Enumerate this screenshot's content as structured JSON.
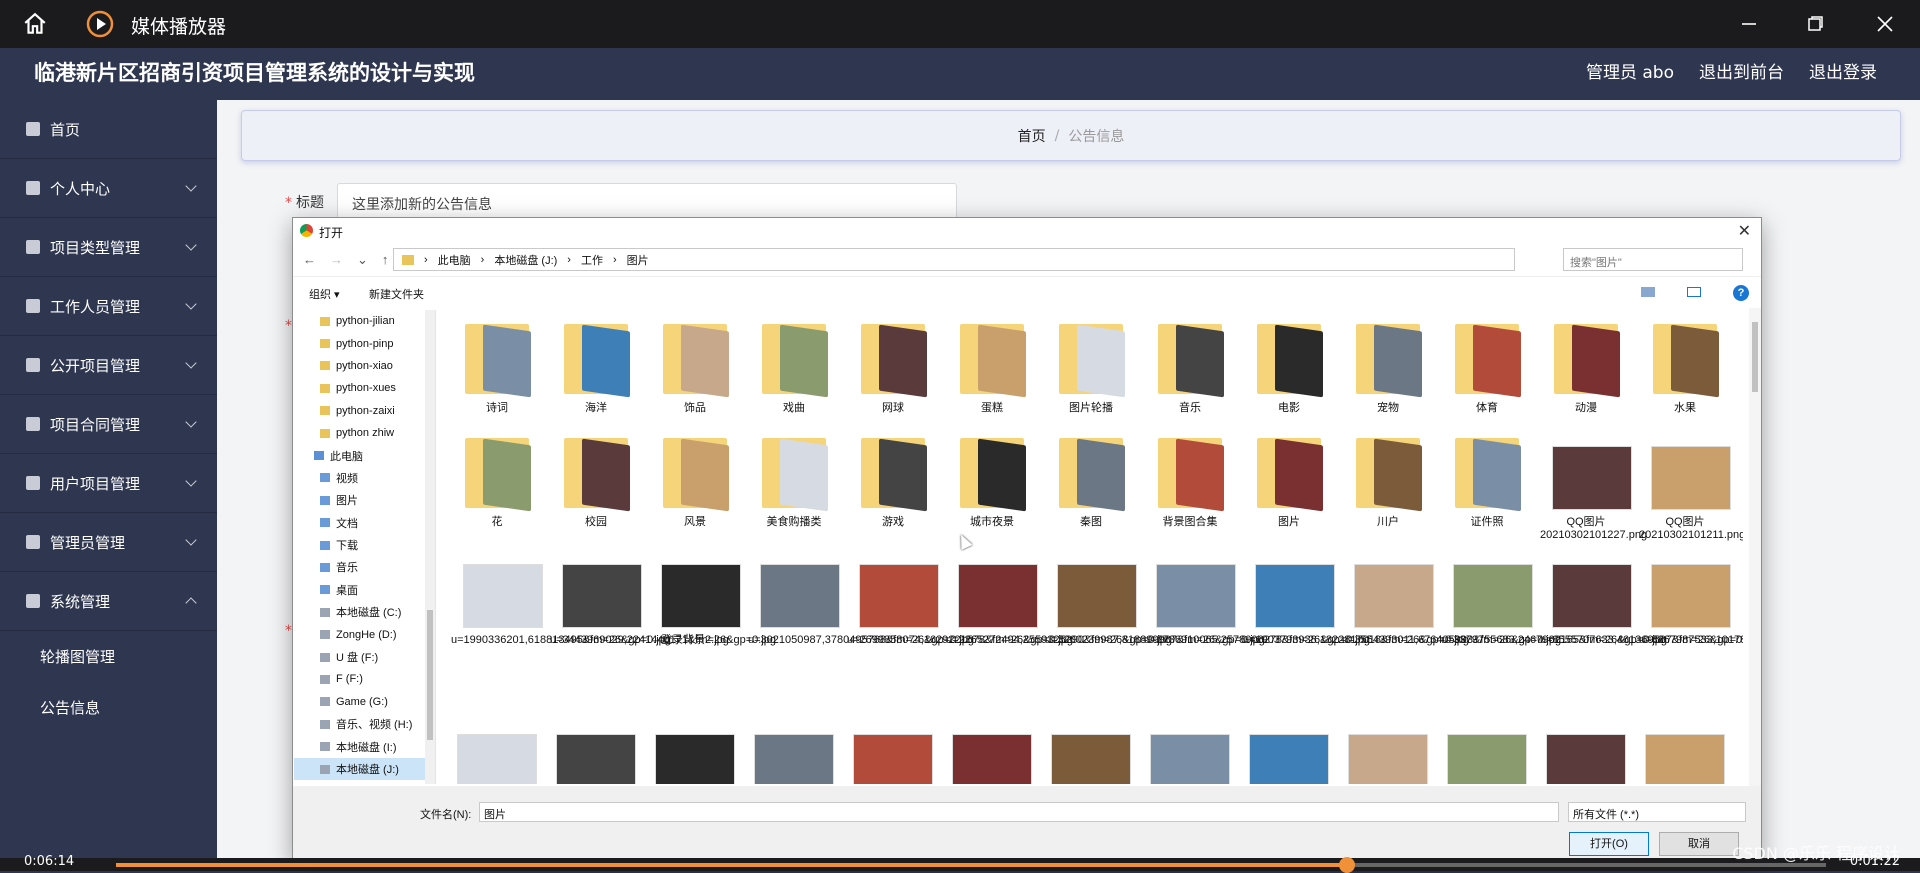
{
  "player": {
    "title": "媒体播放器",
    "current_time": "0:06:14",
    "duration": "0:01:22",
    "progress_fraction": 0.72
  },
  "app": {
    "system_title": "临港新片区招商引资项目管理系统的设计与实现",
    "user": "管理员 abo",
    "to_front": "退出到前台",
    "logout": "退出登录"
  },
  "sidebar": {
    "items": [
      {
        "label": "首页",
        "chev": ""
      },
      {
        "label": "个人中心",
        "chev": "down"
      },
      {
        "label": "项目类型管理",
        "chev": "down"
      },
      {
        "label": "工作人员管理",
        "chev": "down"
      },
      {
        "label": "公开项目管理",
        "chev": "down"
      },
      {
        "label": "项目合同管理",
        "chev": "down"
      },
      {
        "label": "用户项目管理",
        "chev": "down"
      },
      {
        "label": "管理员管理",
        "chev": "down"
      },
      {
        "label": "系统管理",
        "chev": "up"
      }
    ],
    "subs": [
      "轮播图管理",
      "公告信息"
    ]
  },
  "breadcrumb": {
    "home": "首页",
    "sep": "/",
    "current": "公告信息"
  },
  "form": {
    "title_label": "标题",
    "title_placeholder": "这里添加新的公告信息"
  },
  "dialog": {
    "title": "打开",
    "path": [
      "此电脑",
      "本地磁盘 (J:)",
      "工作",
      "图片"
    ],
    "search_placeholder": "搜索\"图片\"",
    "organize": "组织 ▾",
    "new_folder": "新建文件夹",
    "help": "?",
    "tree": [
      "python-jilian",
      "python-pinp",
      "python-xiao",
      "python-xues",
      "python-zaixi",
      "python zhiw",
      "此电脑",
      "视频",
      "图片",
      "文档",
      "下载",
      "音乐",
      "桌面",
      "本地磁盘 (C:)",
      "ZongHe (D:)",
      "U 盘 (F:)",
      "F (F:)",
      "Game (G:)",
      "音乐、视频 (H:)",
      "本地磁盘 (I:)",
      "本地磁盘 (J:)"
    ],
    "folders_row1": [
      "诗词",
      "海洋",
      "饰品",
      "戏曲",
      "网球",
      "蛋糕",
      "图片轮播",
      "音乐",
      "电影",
      "宠物",
      "体育",
      "动漫",
      "水果"
    ],
    "folders_row2": [
      "花",
      "校园",
      "风景",
      "美食购播类",
      "游戏",
      "城市夜景",
      "秦图",
      "背景图合集",
      "图片",
      "川户",
      "证件照"
    ],
    "pngs": [
      {
        "name": "QQ图片20210302101227.png"
      },
      {
        "name": "QQ图片20210302101211.png"
      }
    ],
    "images_row3": [
      "u=1990336201,618813495&fm=26&gp=0.jpg",
      "u=3443969029,2241440171&fm=26&gp=0.jpg",
      "登录背景2.jpg",
      "u=3021050987,3780495768&fm=26&gp=0.jpg",
      "u=2699858074,1629221578&fm=26&gp=0.jpg",
      "u=2265272494,2559325290&fm=26&gp=0.jpg",
      "u=3200239987,818899987&fm=26&gp=0.jpg",
      "u=2736910065,2578906278&fm=26&gp=0.jpg",
      "u=1903793938,1822817018&fm=26&gp=0.jpg",
      "u=3554393011,676405993&fm=26&gp=0.jpg",
      "u=3379755683,2467962165&fm=26&gp=0.jpg",
      "u=8555707633,461369587&fm=26&gp=0.jpg",
      "u=8867987533,1017812494&fm=26&gp=0.jpg"
    ],
    "filename_label": "文件名(N):",
    "filename_value": "图片",
    "filetype": "所有文件 (*.*)",
    "open": "打开(O)",
    "cancel": "取消"
  },
  "watermark": "CSDN @乐乐 程序设计"
}
